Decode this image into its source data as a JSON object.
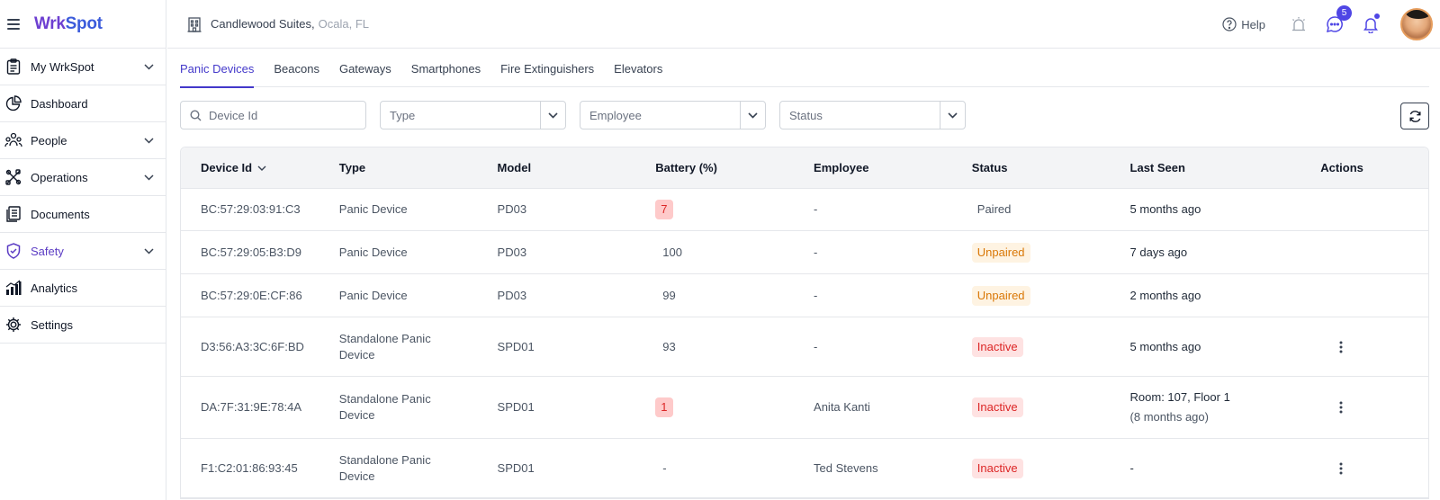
{
  "app": {
    "logo_part1": "Wrk",
    "logo_part2": "Spot"
  },
  "sidebar": {
    "items": [
      {
        "label": "My WrkSpot",
        "icon": "clipboard-icon",
        "expandable": true
      },
      {
        "label": "Dashboard",
        "icon": "pie-chart-icon",
        "expandable": false
      },
      {
        "label": "People",
        "icon": "people-icon",
        "expandable": true
      },
      {
        "label": "Operations",
        "icon": "tools-icon",
        "expandable": true
      },
      {
        "label": "Documents",
        "icon": "document-icon",
        "expandable": false
      },
      {
        "label": "Safety",
        "icon": "shield-icon",
        "expandable": true,
        "active": true
      },
      {
        "label": "Analytics",
        "icon": "analytics-icon",
        "expandable": false
      },
      {
        "label": "Settings",
        "icon": "gear-icon",
        "expandable": false
      }
    ]
  },
  "header": {
    "hotel_name": "Candlewood Suites,",
    "hotel_location": "Ocala, FL",
    "help_label": "Help",
    "chat_badge": "5"
  },
  "tabs": [
    "Panic Devices",
    "Beacons",
    "Gateways",
    "Smartphones",
    "Fire Extinguishers",
    "Elevators"
  ],
  "filters": {
    "search_placeholder": "Device Id",
    "type_placeholder": "Type",
    "employee_placeholder": "Employee",
    "status_placeholder": "Status"
  },
  "table": {
    "columns": [
      "Device Id",
      "Type",
      "Model",
      "Battery (%)",
      "Employee",
      "Status",
      "Last Seen",
      "Actions"
    ],
    "rows": [
      {
        "device_id": "BC:57:29:03:91:C3",
        "type_line1": "Panic Device",
        "type_line2": "",
        "model": "PD03",
        "battery": "7",
        "battery_low": true,
        "employee": "-",
        "status": "Paired",
        "status_kind": "paired",
        "last_seen": "5 months ago",
        "last_seen_sub": "",
        "has_actions": false
      },
      {
        "device_id": "BC:57:29:05:B3:D9",
        "type_line1": "Panic Device",
        "type_line2": "",
        "model": "PD03",
        "battery": "100",
        "battery_low": false,
        "employee": "-",
        "status": "Unpaired",
        "status_kind": "unpaired",
        "last_seen": "7 days ago",
        "last_seen_sub": "",
        "has_actions": false
      },
      {
        "device_id": "BC:57:29:0E:CF:86",
        "type_line1": "Panic Device",
        "type_line2": "",
        "model": "PD03",
        "battery": "99",
        "battery_low": false,
        "employee": "-",
        "status": "Unpaired",
        "status_kind": "unpaired",
        "last_seen": "2 months ago",
        "last_seen_sub": "",
        "has_actions": false
      },
      {
        "device_id": "D3:56:A3:3C:6F:BD",
        "type_line1": "Standalone Panic",
        "type_line2": "Device",
        "model": "SPD01",
        "battery": "93",
        "battery_low": false,
        "employee": "-",
        "status": "Inactive",
        "status_kind": "inactive",
        "last_seen": "5 months ago",
        "last_seen_sub": "",
        "has_actions": true
      },
      {
        "device_id": "DA:7F:31:9E:78:4A",
        "type_line1": "Standalone Panic",
        "type_line2": "Device",
        "model": "SPD01",
        "battery": "1",
        "battery_low": true,
        "employee": "Anita Kanti",
        "status": "Inactive",
        "status_kind": "inactive",
        "last_seen": "Room: 107, Floor 1",
        "last_seen_sub": "(8 months ago)",
        "has_actions": true
      },
      {
        "device_id": "F1:C2:01:86:93:45",
        "type_line1": "Standalone Panic",
        "type_line2": "Device",
        "model": "SPD01",
        "battery": "-",
        "battery_low": false,
        "employee": "Ted Stevens",
        "status": "Inactive",
        "status_kind": "inactive",
        "last_seen": "-",
        "last_seen_sub": "",
        "has_actions": true
      }
    ]
  },
  "colors": {
    "accent": "#4338ca",
    "brand": "#6d3fd1",
    "inactive": "#dc2626",
    "unpaired": "#d97706"
  }
}
